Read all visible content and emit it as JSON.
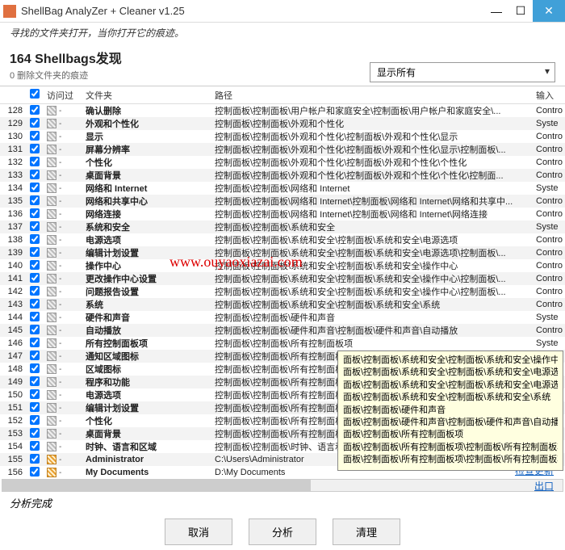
{
  "titlebar": {
    "text": "ShellBag  AnalyZer + Cleaner v1.25"
  },
  "subtitle": "寻找的文件夹打开，当你打开它的痕迹。",
  "header": {
    "count": "164 Shellbags发现",
    "sub": "0 删除文件夹的痕迹"
  },
  "filter": {
    "label": "显示所有"
  },
  "columns": {
    "visited": "访问过",
    "folder": "文件夹",
    "path": "路径",
    "input": "输入"
  },
  "rows": [
    {
      "idx": "128",
      "ico": "grey",
      "folder": "确认删除",
      "path": "控制面板\\控制面板\\用户帐户和家庭安全\\控制面板\\用户帐户和家庭安全\\...",
      "input": "Contro"
    },
    {
      "idx": "129",
      "ico": "grey",
      "folder": "外观和个性化",
      "path": "控制面板\\控制面板\\外观和个性化",
      "input": "Syste"
    },
    {
      "idx": "130",
      "ico": "grey",
      "folder": "显示",
      "path": "控制面板\\控制面板\\外观和个性化\\控制面板\\外观和个性化\\显示",
      "input": "Contro"
    },
    {
      "idx": "131",
      "ico": "grey",
      "folder": "屏幕分辨率",
      "path": "控制面板\\控制面板\\外观和个性化\\控制面板\\外观和个性化\\显示\\控制面板\\...",
      "input": "Contro"
    },
    {
      "idx": "132",
      "ico": "grey",
      "folder": "个性化",
      "path": "控制面板\\控制面板\\外观和个性化\\控制面板\\外观和个性化\\个性化",
      "input": "Contro"
    },
    {
      "idx": "133",
      "ico": "grey",
      "folder": "桌面背景",
      "path": "控制面板\\控制面板\\外观和个性化\\控制面板\\外观和个性化\\个性化\\控制面...",
      "input": "Contro"
    },
    {
      "idx": "134",
      "ico": "grey",
      "folder": "网络和 Internet",
      "path": "控制面板\\控制面板\\网络和 Internet",
      "input": "Syste"
    },
    {
      "idx": "135",
      "ico": "grey",
      "folder": "网络和共享中心",
      "path": "控制面板\\控制面板\\网络和 Internet\\控制面板\\网络和 Internet\\网络和共享中...",
      "input": "Contro"
    },
    {
      "idx": "136",
      "ico": "grey",
      "folder": "网络连接",
      "path": "控制面板\\控制面板\\网络和 Internet\\控制面板\\网络和 Internet\\网络连接",
      "input": "Contro"
    },
    {
      "idx": "137",
      "ico": "grey",
      "folder": "系统和安全",
      "path": "控制面板\\控制面板\\系统和安全",
      "input": "Syste"
    },
    {
      "idx": "138",
      "ico": "grey",
      "folder": "电源选项",
      "path": "控制面板\\控制面板\\系统和安全\\控制面板\\系统和安全\\电源选项",
      "input": "Contro"
    },
    {
      "idx": "139",
      "ico": "grey",
      "folder": "编辑计划设置",
      "path": "控制面板\\控制面板\\系统和安全\\控制面板\\系统和安全\\电源选项\\控制面板\\...",
      "input": "Contro"
    },
    {
      "idx": "140",
      "ico": "grey",
      "folder": "操作中心",
      "path": "控制面板\\控制面板\\系统和安全\\控制面板\\系统和安全\\操作中心",
      "input": "Contro"
    },
    {
      "idx": "141",
      "ico": "grey",
      "folder": "更改操作中心设置",
      "path": "控制面板\\控制面板\\系统和安全\\控制面板\\系统和安全\\操作中心\\控制面板\\...",
      "input": "Contro"
    },
    {
      "idx": "142",
      "ico": "grey",
      "folder": "问题报告设置",
      "path": "控制面板\\控制面板\\系统和安全\\控制面板\\系统和安全\\操作中心\\控制面板\\...",
      "input": "Contro"
    },
    {
      "idx": "143",
      "ico": "grey",
      "folder": "系统",
      "path": "控制面板\\控制面板\\系统和安全\\控制面板\\系统和安全\\系统",
      "input": "Contro"
    },
    {
      "idx": "144",
      "ico": "grey",
      "folder": "硬件和声音",
      "path": "控制面板\\控制面板\\硬件和声音",
      "input": "Syste"
    },
    {
      "idx": "145",
      "ico": "grey",
      "folder": "自动播放",
      "path": "控制面板\\控制面板\\硬件和声音\\控制面板\\硬件和声音\\自动播放",
      "input": "Contro"
    },
    {
      "idx": "146",
      "ico": "grey",
      "folder": "所有控制面板项",
      "path": "控制面板\\控制面板\\所有控制面板项",
      "input": "Syste"
    },
    {
      "idx": "147",
      "ico": "grey",
      "folder": "通知区域图标",
      "path": "控制面板\\控制面板\\所有控制面板项\\控制面板\\所有控制面板项\\通知区域...",
      "input": "Contro"
    },
    {
      "idx": "148",
      "ico": "grey",
      "folder": "区域图标",
      "path": "控制面板\\控制面板\\所有控制面板项\\控制面板\\所有控制面板项\\通知区域...",
      "input": "Contro"
    },
    {
      "idx": "149",
      "ico": "grey",
      "folder": "程序和功能",
      "path": "控制面板\\控制面板\\所有控制面板项\\控制面板\\所有控制面板项\\程序和功能",
      "input": ""
    },
    {
      "idx": "150",
      "ico": "grey",
      "folder": "电源选项",
      "path": "控制面板\\控制面板\\所有控制面板项\\控制面板\\系统和安全\\操作中心",
      "input": ""
    },
    {
      "idx": "151",
      "ico": "grey",
      "folder": "编辑计划设置",
      "path": "控制面板\\控制面板\\所有控制面板项\\系统和安全\\电源选项",
      "input": ""
    },
    {
      "idx": "152",
      "ico": "grey",
      "folder": "个性化",
      "path": "控制面板\\控制面板\\所有控制面板项\\系统和安全\\电源选项\\控制面板\\...",
      "input": ""
    },
    {
      "idx": "153",
      "ico": "grey",
      "folder": "桌面背景",
      "path": "控制面板\\控制面板\\所有控制面板项\\系统和安全\\系统",
      "input": ""
    },
    {
      "idx": "154",
      "ico": "grey",
      "folder": "时钟、语言和区域",
      "path": "控制面板\\控制面板\\时钟、语言和区域\\硬件和声音",
      "input": ""
    },
    {
      "idx": "155",
      "ico": "orange",
      "folder": "Administrator",
      "path": "C:\\Users\\Administrator",
      "input": ""
    },
    {
      "idx": "156",
      "ico": "orange",
      "folder": "My Documents",
      "path": "D:\\My Documents",
      "input": ""
    }
  ],
  "tooltip": {
    "lines": [
      "面板\\控制面板\\系统和安全\\控制面板\\系统和安全\\操作中心",
      "面板\\控制面板\\系统和安全\\控制面板\\系统和安全\\电源选项",
      "面板\\控制面板\\系统和安全\\控制面板\\系统和安全\\电源选项\\控制面板\\...",
      "面板\\控制面板\\系统和安全\\控制面板\\系统和安全\\系统",
      "面板\\控制面板\\硬件和声音",
      "面板\\控制面板\\硬件和声音\\控制面板\\硬件和声音\\自动播放",
      "面板\\控制面板\\所有控制面板项",
      "面板\\控制面板\\所有控制面板项\\控制面板\\所有控制面板项\\通知区...",
      "面板\\控制面板\\所有控制面板项\\控制面板\\所有控制面板项\\通知区..."
    ]
  },
  "watermark": "www.ouyaoxiazai.com",
  "status": "分析完成",
  "buttons": {
    "cancel": "取消",
    "analyze": "分析",
    "clean": "清理"
  },
  "links": {
    "check": "检查更新",
    "exit": "出口"
  }
}
